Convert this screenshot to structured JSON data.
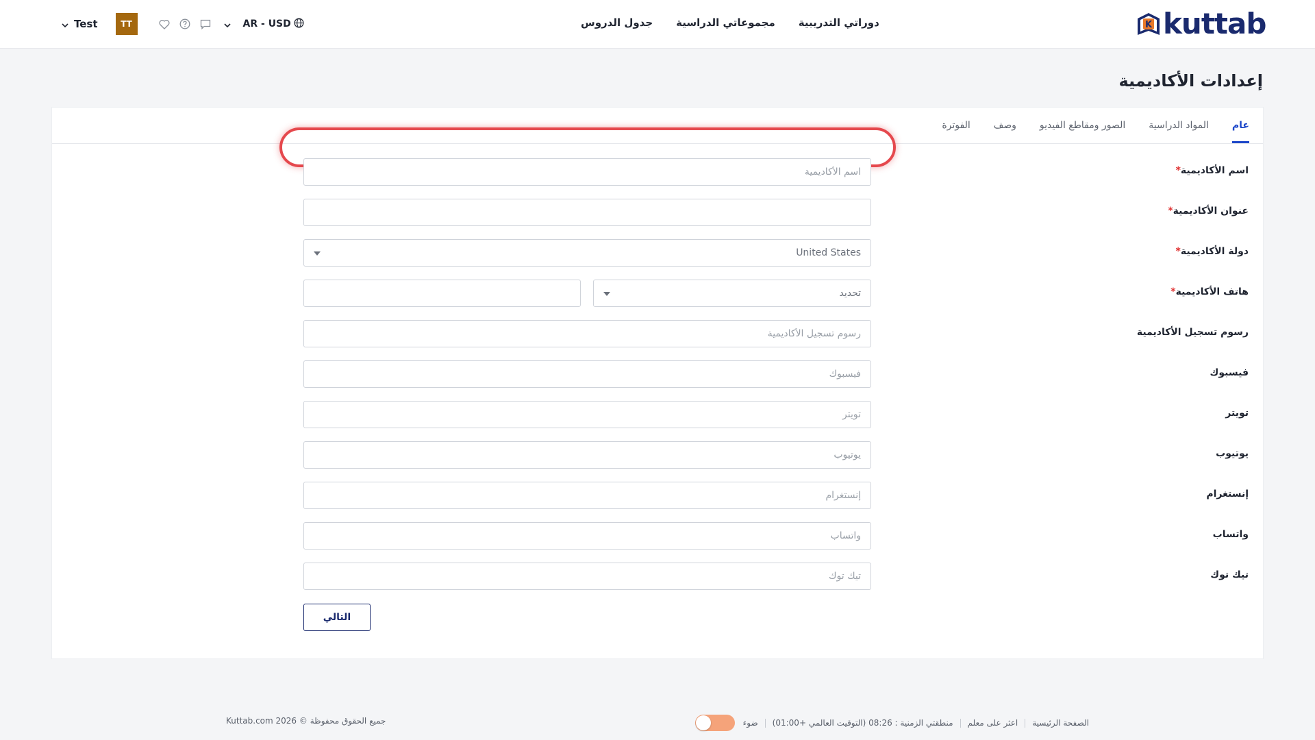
{
  "header": {
    "logo_text": "kuttab",
    "logo_mark_letter": "K",
    "brand_color": "#1a2a6e",
    "nav": [
      {
        "label": "جدول الدروس"
      },
      {
        "label": "مجموعاتي الدراسية"
      },
      {
        "label": "دوراتي التدريبية"
      }
    ],
    "user_name": "Test",
    "avatar_initials": "TT",
    "avatar_color": "#a4680f",
    "language_currency": "AR - USD"
  },
  "page": {
    "title": "إعدادات الأكاديمية"
  },
  "tabs": [
    {
      "label": "عام",
      "active": true
    },
    {
      "label": "المواد الدراسية",
      "active": false
    },
    {
      "label": "الصور ومقاطع الفيديو",
      "active": false
    },
    {
      "label": "وصف",
      "active": false
    },
    {
      "label": "الفوترة",
      "active": false
    }
  ],
  "form": {
    "required_mark": "*",
    "academy_name": {
      "label": "اسم الأكاديمية",
      "placeholder": "اسم الأكاديمية",
      "value": ""
    },
    "academy_address": {
      "label": "عنوان الأكاديمية",
      "placeholder": "",
      "value": ""
    },
    "academy_country": {
      "label": "دولة الأكاديمية",
      "selected": "United States"
    },
    "academy_phone": {
      "label": "هاتف الأكاديمية",
      "code_selected": "تحديد",
      "number_value": ""
    },
    "registration_fee": {
      "label": "رسوم تسجيل الأكاديمية",
      "placeholder": "رسوم تسجيل الأكاديمية"
    },
    "facebook": {
      "label": "فيسبوك",
      "placeholder": "فيسبوك"
    },
    "twitter": {
      "label": "تويتر",
      "placeholder": "تويتر"
    },
    "youtube": {
      "label": "يوتيوب",
      "placeholder": "يوتيوب"
    },
    "instagram": {
      "label": "إنستغرام",
      "placeholder": "إنستغرام"
    },
    "whatsapp": {
      "label": "واتساب",
      "placeholder": "واتساب"
    },
    "tiktok": {
      "label": "تيك توك",
      "placeholder": "تيك توك"
    },
    "next_label": "التالي"
  },
  "footer": {
    "home": "الصفحة الرئيسية",
    "find_teacher": "اعثر على معلم",
    "timezone": "منطقتي الزمنية : 08:26 (التوقيت العالمي +01:00)",
    "theme_label": "ضوء",
    "copyright": "جميع الحقوق محفوظة © 2026 Kuttab.com"
  },
  "icons": {
    "heart": "heart-icon",
    "help": "help-circle-icon",
    "chat": "chat-icon",
    "globe": "globe-icon",
    "chevron": "chevron-down-icon"
  },
  "colors": {
    "accent": "#1d47c9",
    "highlight": "#e5484d",
    "toggle": "#f5a37a"
  }
}
